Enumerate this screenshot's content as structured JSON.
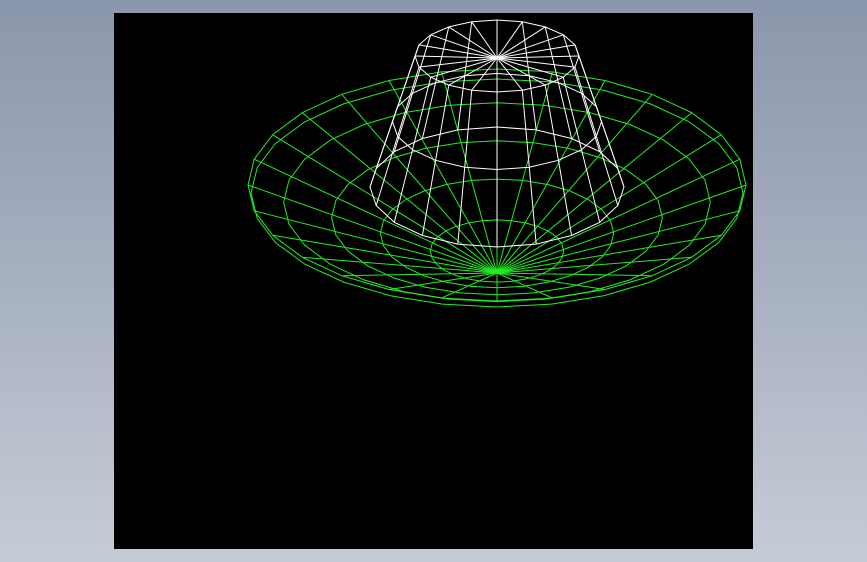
{
  "scene": {
    "background_color": "#000000",
    "frame_color": "#9aa4b6",
    "objects": [
      {
        "name": "dish",
        "shape": "shallow bowl wireframe",
        "color": "#22ee22",
        "radial_segments": 28,
        "rings": 5
      },
      {
        "name": "frustum",
        "shape": "truncated cone wireframe",
        "color": "#ffffff",
        "radial_segments": 20,
        "rings": 3
      }
    ]
  }
}
